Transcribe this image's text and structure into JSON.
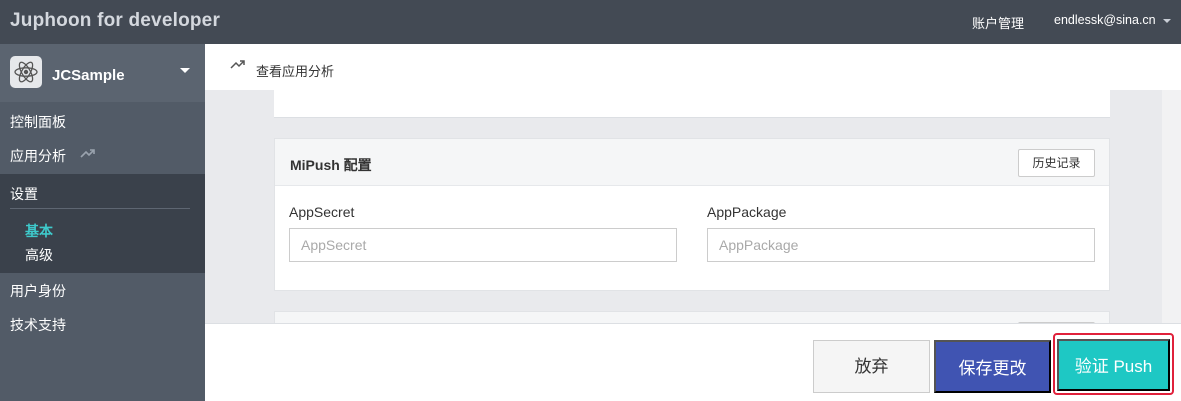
{
  "topbar": {
    "brand": "Juphoon for developer",
    "account_link": "账户管理",
    "user_email": "endlessk@sina.cn"
  },
  "sidebar": {
    "app_name": "JCSample",
    "items": [
      {
        "label": "控制面板"
      },
      {
        "label": "应用分析"
      },
      {
        "label": "设置"
      },
      {
        "label": "用户身份"
      },
      {
        "label": "技术支持"
      }
    ],
    "settings_sub": [
      {
        "label": "基本",
        "active": true
      },
      {
        "label": "高级"
      }
    ]
  },
  "content_header": {
    "title": "查看应用分析"
  },
  "mipush": {
    "title": "MiPush 配置",
    "history_button": "历史记录",
    "app_secret_label": "AppSecret",
    "app_secret_placeholder": "AppSecret",
    "app_package_label": "AppPackage",
    "app_package_placeholder": "AppPackage"
  },
  "actions": {
    "discard": "放弃",
    "save": "保存更改",
    "verify_push": "验证 Push"
  },
  "colors": {
    "topbar": "#434a54",
    "sidebar": "#525b67",
    "accent_teal": "#1ec8c4",
    "save_blue": "#4054b2",
    "highlight_red": "#e0213b"
  },
  "icons": [
    "atom-icon",
    "caret-down-icon",
    "trend-icon"
  ]
}
